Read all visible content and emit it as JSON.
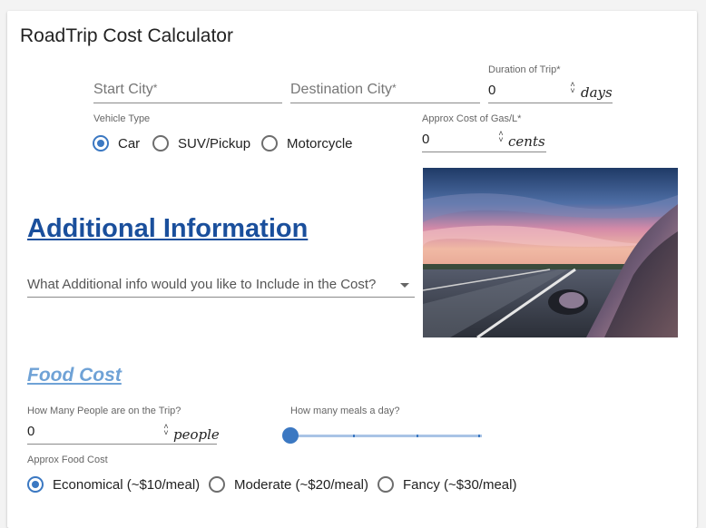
{
  "app": {
    "title": "RoadTrip Cost Calculator"
  },
  "trip": {
    "start_city_label": "Start City",
    "destination_city_label": "Destination City",
    "required_mark": "*",
    "duration_label": "Duration of Trip",
    "duration_value": "0",
    "duration_unit": "days"
  },
  "vehicle": {
    "label": "Vehicle Type",
    "options": [
      "Car",
      "SUV/Pickup",
      "Motorcycle"
    ],
    "selected": "Car"
  },
  "gas": {
    "label": "Approx Cost of Gas/L",
    "value": "0",
    "unit": "cents"
  },
  "additional": {
    "heading": "Additional Information",
    "select_placeholder": "What Additional info would you like to Include in the Cost?"
  },
  "food": {
    "heading": "Food Cost",
    "people_label": "How Many People are on the Trip?",
    "people_value": "0",
    "people_unit": "people",
    "meals_label": "How many meals a day?",
    "meals_slider_value": 0,
    "food_cost_label": "Approx Food Cost",
    "options": [
      "Economical (~$10/meal)",
      "Moderate (~$20/meal)",
      "Fancy (~$30/meal)"
    ],
    "selected": "Economical (~$10/meal)"
  },
  "colors": {
    "accent": "#3b78c2",
    "heading_dark": "#1a4f9c",
    "heading_light": "#6fa2d6"
  },
  "icons": {
    "spinner": "spinner-arrows-icon",
    "dropdown": "dropdown-caret-icon",
    "image": "road-car-photo"
  }
}
